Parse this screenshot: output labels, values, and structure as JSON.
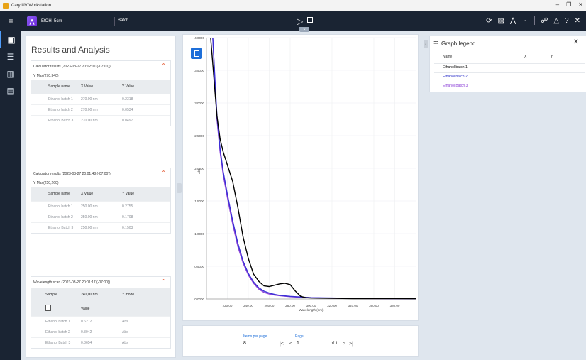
{
  "window": {
    "title": "Cary UV Workstation"
  },
  "header": {
    "experiment_name": "EtOH_5cm",
    "batch_label": "Batch"
  },
  "results": {
    "title": "Results and Analysis",
    "cards": [
      {
        "heading": "Calculator results (2023-03-27 20:02:01 (-07:00))",
        "subheading": "Y Max(270,340)",
        "columns": [
          "Sample name",
          "X Value",
          "Y Value"
        ],
        "rows": [
          [
            "Ethanol batch 1",
            "270.00 nm",
            "0.2318"
          ],
          [
            "Ethanol batch 2",
            "270.00 nm",
            "0.0534"
          ],
          [
            "Ethanol Batch 3",
            "270.00 nm",
            "0.0497"
          ]
        ]
      },
      {
        "heading": "Calculator results (2023-03-27 20:01:48 (-07:00))",
        "subheading": "Y Max(250,260)",
        "columns": [
          "Sample name",
          "X Value",
          "Y Value"
        ],
        "rows": [
          [
            "Ethanol batch 1",
            "250.00 nm",
            "0.2755"
          ],
          [
            "Ethanol batch 2",
            "250.00 nm",
            "0.1708"
          ],
          [
            "Ethanol Batch 3",
            "250.00 nm",
            "0.1503"
          ]
        ]
      },
      {
        "heading": "Wavelength scan (2023-03-27 20:01:17 (-07:00))",
        "columns": [
          "Sample",
          "240,00 nm",
          "Y mode"
        ],
        "value_label": "Value",
        "rows": [
          [
            "Ethanol batch 1",
            "0.6212",
            "Abs"
          ],
          [
            "Ethanol batch 2",
            "0.3942",
            "Abs"
          ],
          [
            "Ethanol Batch 3",
            "0.3654",
            "Abs"
          ]
        ]
      }
    ]
  },
  "chart_data": {
    "type": "line",
    "xlabel": "Wavelength (nm)",
    "ylabel": "Abs",
    "xlim": [
      200,
      400
    ],
    "ylim": [
      0,
      4.0
    ],
    "x_ticks": [
      "220.00",
      "240.00",
      "260.00",
      "280.00",
      "300.00",
      "320.00",
      "340.00",
      "360.00",
      "380.00"
    ],
    "y_ticks": [
      "0.0000",
      "0.5000",
      "1.0000",
      "1.5000",
      "2.0000",
      "2.5000",
      "3.0000",
      "3.5000",
      "4.0000"
    ],
    "grid": true,
    "series": [
      {
        "name": "Ethanol batch 1",
        "color": "#000000",
        "x": [
          204,
          206,
          208,
          210,
          213,
          216,
          220,
          225,
          230,
          235,
          240,
          245,
          250,
          255,
          260,
          265,
          270,
          275,
          280,
          285,
          290,
          295,
          300,
          320,
          340,
          360,
          380,
          400
        ],
        "y": [
          4.0,
          3.6,
          3.2,
          2.8,
          2.45,
          2.25,
          2.05,
          1.8,
          1.4,
          0.95,
          0.62,
          0.38,
          0.27,
          0.2,
          0.19,
          0.21,
          0.23,
          0.24,
          0.22,
          0.12,
          0.04,
          0.02,
          0.015,
          0.01,
          0.005,
          0.005,
          0.004,
          0.003
        ]
      },
      {
        "name": "Ethanol batch 2",
        "color": "#3a2fd6",
        "x": [
          206,
          208,
          210,
          213,
          216,
          220,
          225,
          230,
          235,
          240,
          245,
          250,
          255,
          260,
          265,
          270,
          280,
          290,
          300,
          320,
          340,
          360,
          380,
          400
        ],
        "y": [
          4.0,
          3.4,
          2.8,
          2.3,
          1.95,
          1.6,
          1.2,
          0.85,
          0.58,
          0.39,
          0.26,
          0.17,
          0.12,
          0.09,
          0.07,
          0.055,
          0.04,
          0.03,
          0.02,
          0.015,
          0.01,
          0.008,
          0.006,
          0.005
        ]
      },
      {
        "name": "Ethanol Batch 3",
        "color": "#8e44d8",
        "x": [
          206,
          208,
          210,
          213,
          216,
          220,
          225,
          230,
          235,
          240,
          245,
          250,
          255,
          260,
          265,
          270,
          280,
          290,
          300,
          320,
          340,
          360,
          380,
          400
        ],
        "y": [
          4.0,
          3.35,
          2.75,
          2.25,
          1.9,
          1.55,
          1.15,
          0.8,
          0.55,
          0.365,
          0.24,
          0.15,
          0.1,
          0.075,
          0.06,
          0.05,
          0.035,
          0.025,
          0.018,
          0.012,
          0.009,
          0.007,
          0.005,
          0.004
        ]
      }
    ]
  },
  "pager": {
    "items_label": "Items per page",
    "items_value": "8",
    "page_label": "Page",
    "page_value": "1",
    "of_text": "of 1"
  },
  "legend": {
    "title": "Graph legend",
    "columns": [
      "Name",
      "X",
      "Y"
    ],
    "entries": [
      {
        "name": "Ethanol batch 1",
        "color": "#000000"
      },
      {
        "name": "Ethanol batch 2",
        "color": "#2a2fc8"
      },
      {
        "name": "Ethanol Batch 3",
        "color": "#8e44d8"
      }
    ]
  }
}
